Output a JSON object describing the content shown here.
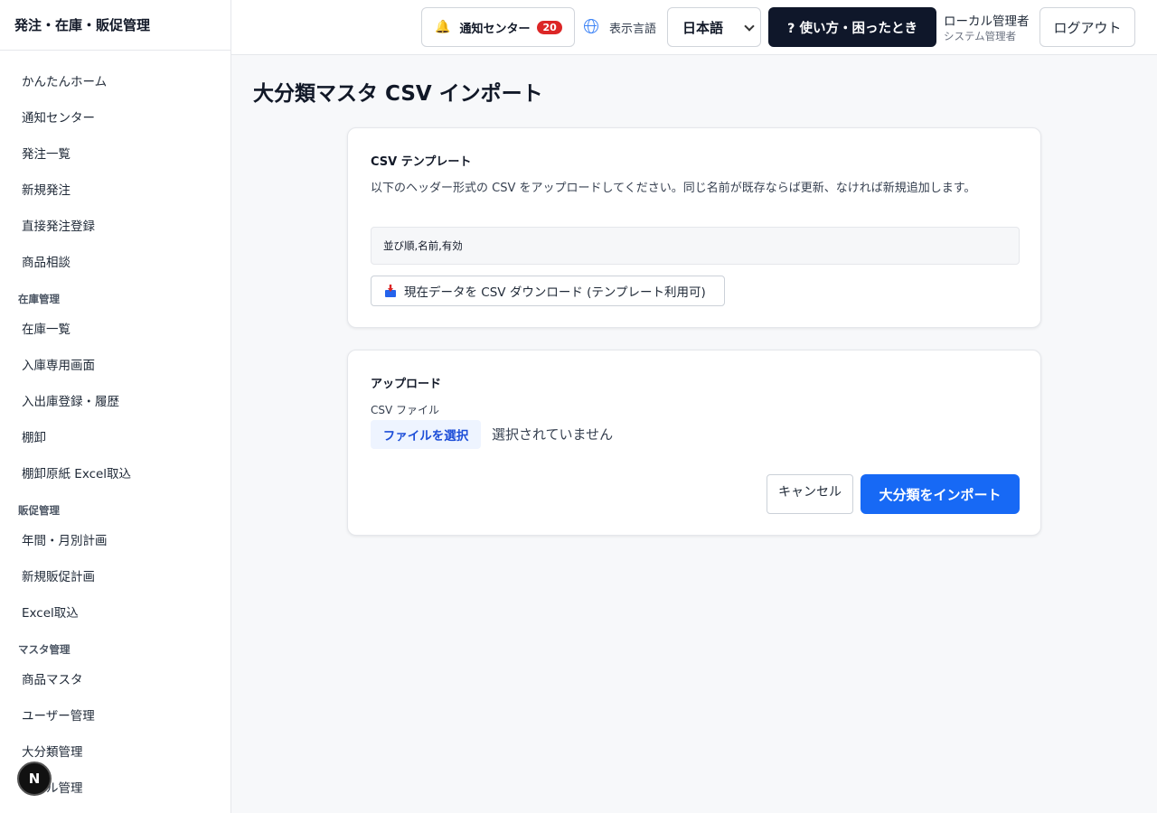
{
  "app": {
    "title": "発注・在庫・販促管理"
  },
  "sidebar": {
    "top_items": [
      "かんたんホーム",
      "通知センター",
      "発注一覧",
      "新規発注",
      "直接発注登録",
      "商品相談"
    ],
    "sections": [
      {
        "title": "在庫管理",
        "items": [
          "在庫一覧",
          "入庫専用画面",
          "入出庫登録・履歴",
          "棚卸",
          "棚卸原紙 Excel取込"
        ]
      },
      {
        "title": "販促管理",
        "items": [
          "年間・月別計画",
          "新規販促計画",
          "Excel取込"
        ]
      },
      {
        "title": "マスタ管理",
        "items": [
          "商品マスタ",
          "ユーザー管理",
          "大分類管理",
          "ホテル管理"
        ]
      }
    ],
    "floating_badge": "N"
  },
  "header": {
    "notification": {
      "label": "通知センター",
      "count": "20",
      "icon": "bell-icon"
    },
    "language": {
      "label": "表示言語",
      "selected": "日本語",
      "icon": "globe-icon"
    },
    "help_label": "? 使い方・困ったとき",
    "user": {
      "name": "ローカル管理者",
      "role": "システム管理者"
    },
    "logout_label": "ログアウト"
  },
  "main": {
    "page_title": "大分類マスタ CSV インポート",
    "template_card": {
      "title": "CSV テンプレート",
      "description": "以下のヘッダー形式の CSV をアップロードしてください。同じ名前が既存ならば更新、なければ新規追加します。",
      "header_format": "並び順,名前,有効",
      "download_label": "現在データを CSV ダウンロード (テンプレート利用可)",
      "download_icon": "inbox-tray-icon"
    },
    "upload_card": {
      "title": "アップロード",
      "file_label": "CSV ファイル",
      "choose_file_label": "ファイルを選択",
      "no_file_text": "選択されていません",
      "cancel_label": "キャンセル",
      "import_label": "大分類をインポート"
    }
  },
  "colors": {
    "primary": "#1769f5",
    "dark": "#0f172a",
    "badge": "#dc2626"
  }
}
